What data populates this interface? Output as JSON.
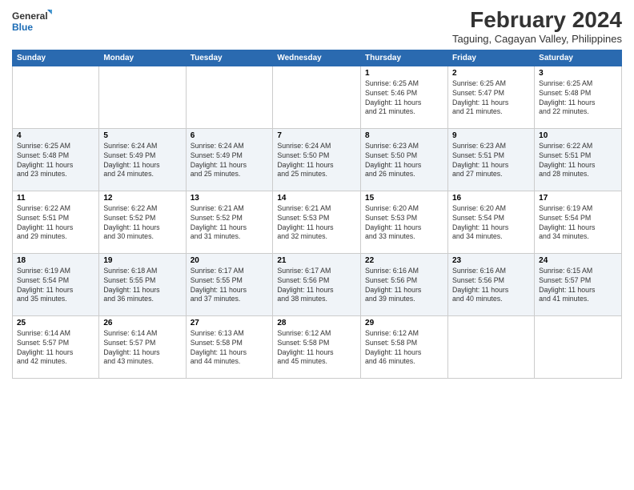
{
  "header": {
    "logo_line1": "General",
    "logo_line2": "Blue",
    "title": "February 2024",
    "subtitle": "Taguing, Cagayan Valley, Philippines"
  },
  "calendar": {
    "days_of_week": [
      "Sunday",
      "Monday",
      "Tuesday",
      "Wednesday",
      "Thursday",
      "Friday",
      "Saturday"
    ],
    "weeks": [
      [
        {
          "num": "",
          "info": ""
        },
        {
          "num": "",
          "info": ""
        },
        {
          "num": "",
          "info": ""
        },
        {
          "num": "",
          "info": ""
        },
        {
          "num": "1",
          "info": "Sunrise: 6:25 AM\nSunset: 5:46 PM\nDaylight: 11 hours\nand 21 minutes."
        },
        {
          "num": "2",
          "info": "Sunrise: 6:25 AM\nSunset: 5:47 PM\nDaylight: 11 hours\nand 21 minutes."
        },
        {
          "num": "3",
          "info": "Sunrise: 6:25 AM\nSunset: 5:48 PM\nDaylight: 11 hours\nand 22 minutes."
        }
      ],
      [
        {
          "num": "4",
          "info": "Sunrise: 6:25 AM\nSunset: 5:48 PM\nDaylight: 11 hours\nand 23 minutes."
        },
        {
          "num": "5",
          "info": "Sunrise: 6:24 AM\nSunset: 5:49 PM\nDaylight: 11 hours\nand 24 minutes."
        },
        {
          "num": "6",
          "info": "Sunrise: 6:24 AM\nSunset: 5:49 PM\nDaylight: 11 hours\nand 25 minutes."
        },
        {
          "num": "7",
          "info": "Sunrise: 6:24 AM\nSunset: 5:50 PM\nDaylight: 11 hours\nand 25 minutes."
        },
        {
          "num": "8",
          "info": "Sunrise: 6:23 AM\nSunset: 5:50 PM\nDaylight: 11 hours\nand 26 minutes."
        },
        {
          "num": "9",
          "info": "Sunrise: 6:23 AM\nSunset: 5:51 PM\nDaylight: 11 hours\nand 27 minutes."
        },
        {
          "num": "10",
          "info": "Sunrise: 6:22 AM\nSunset: 5:51 PM\nDaylight: 11 hours\nand 28 minutes."
        }
      ],
      [
        {
          "num": "11",
          "info": "Sunrise: 6:22 AM\nSunset: 5:51 PM\nDaylight: 11 hours\nand 29 minutes."
        },
        {
          "num": "12",
          "info": "Sunrise: 6:22 AM\nSunset: 5:52 PM\nDaylight: 11 hours\nand 30 minutes."
        },
        {
          "num": "13",
          "info": "Sunrise: 6:21 AM\nSunset: 5:52 PM\nDaylight: 11 hours\nand 31 minutes."
        },
        {
          "num": "14",
          "info": "Sunrise: 6:21 AM\nSunset: 5:53 PM\nDaylight: 11 hours\nand 32 minutes."
        },
        {
          "num": "15",
          "info": "Sunrise: 6:20 AM\nSunset: 5:53 PM\nDaylight: 11 hours\nand 33 minutes."
        },
        {
          "num": "16",
          "info": "Sunrise: 6:20 AM\nSunset: 5:54 PM\nDaylight: 11 hours\nand 34 minutes."
        },
        {
          "num": "17",
          "info": "Sunrise: 6:19 AM\nSunset: 5:54 PM\nDaylight: 11 hours\nand 34 minutes."
        }
      ],
      [
        {
          "num": "18",
          "info": "Sunrise: 6:19 AM\nSunset: 5:54 PM\nDaylight: 11 hours\nand 35 minutes."
        },
        {
          "num": "19",
          "info": "Sunrise: 6:18 AM\nSunset: 5:55 PM\nDaylight: 11 hours\nand 36 minutes."
        },
        {
          "num": "20",
          "info": "Sunrise: 6:17 AM\nSunset: 5:55 PM\nDaylight: 11 hours\nand 37 minutes."
        },
        {
          "num": "21",
          "info": "Sunrise: 6:17 AM\nSunset: 5:56 PM\nDaylight: 11 hours\nand 38 minutes."
        },
        {
          "num": "22",
          "info": "Sunrise: 6:16 AM\nSunset: 5:56 PM\nDaylight: 11 hours\nand 39 minutes."
        },
        {
          "num": "23",
          "info": "Sunrise: 6:16 AM\nSunset: 5:56 PM\nDaylight: 11 hours\nand 40 minutes."
        },
        {
          "num": "24",
          "info": "Sunrise: 6:15 AM\nSunset: 5:57 PM\nDaylight: 11 hours\nand 41 minutes."
        }
      ],
      [
        {
          "num": "25",
          "info": "Sunrise: 6:14 AM\nSunset: 5:57 PM\nDaylight: 11 hours\nand 42 minutes."
        },
        {
          "num": "26",
          "info": "Sunrise: 6:14 AM\nSunset: 5:57 PM\nDaylight: 11 hours\nand 43 minutes."
        },
        {
          "num": "27",
          "info": "Sunrise: 6:13 AM\nSunset: 5:58 PM\nDaylight: 11 hours\nand 44 minutes."
        },
        {
          "num": "28",
          "info": "Sunrise: 6:12 AM\nSunset: 5:58 PM\nDaylight: 11 hours\nand 45 minutes."
        },
        {
          "num": "29",
          "info": "Sunrise: 6:12 AM\nSunset: 5:58 PM\nDaylight: 11 hours\nand 46 minutes."
        },
        {
          "num": "",
          "info": ""
        },
        {
          "num": "",
          "info": ""
        }
      ]
    ]
  }
}
